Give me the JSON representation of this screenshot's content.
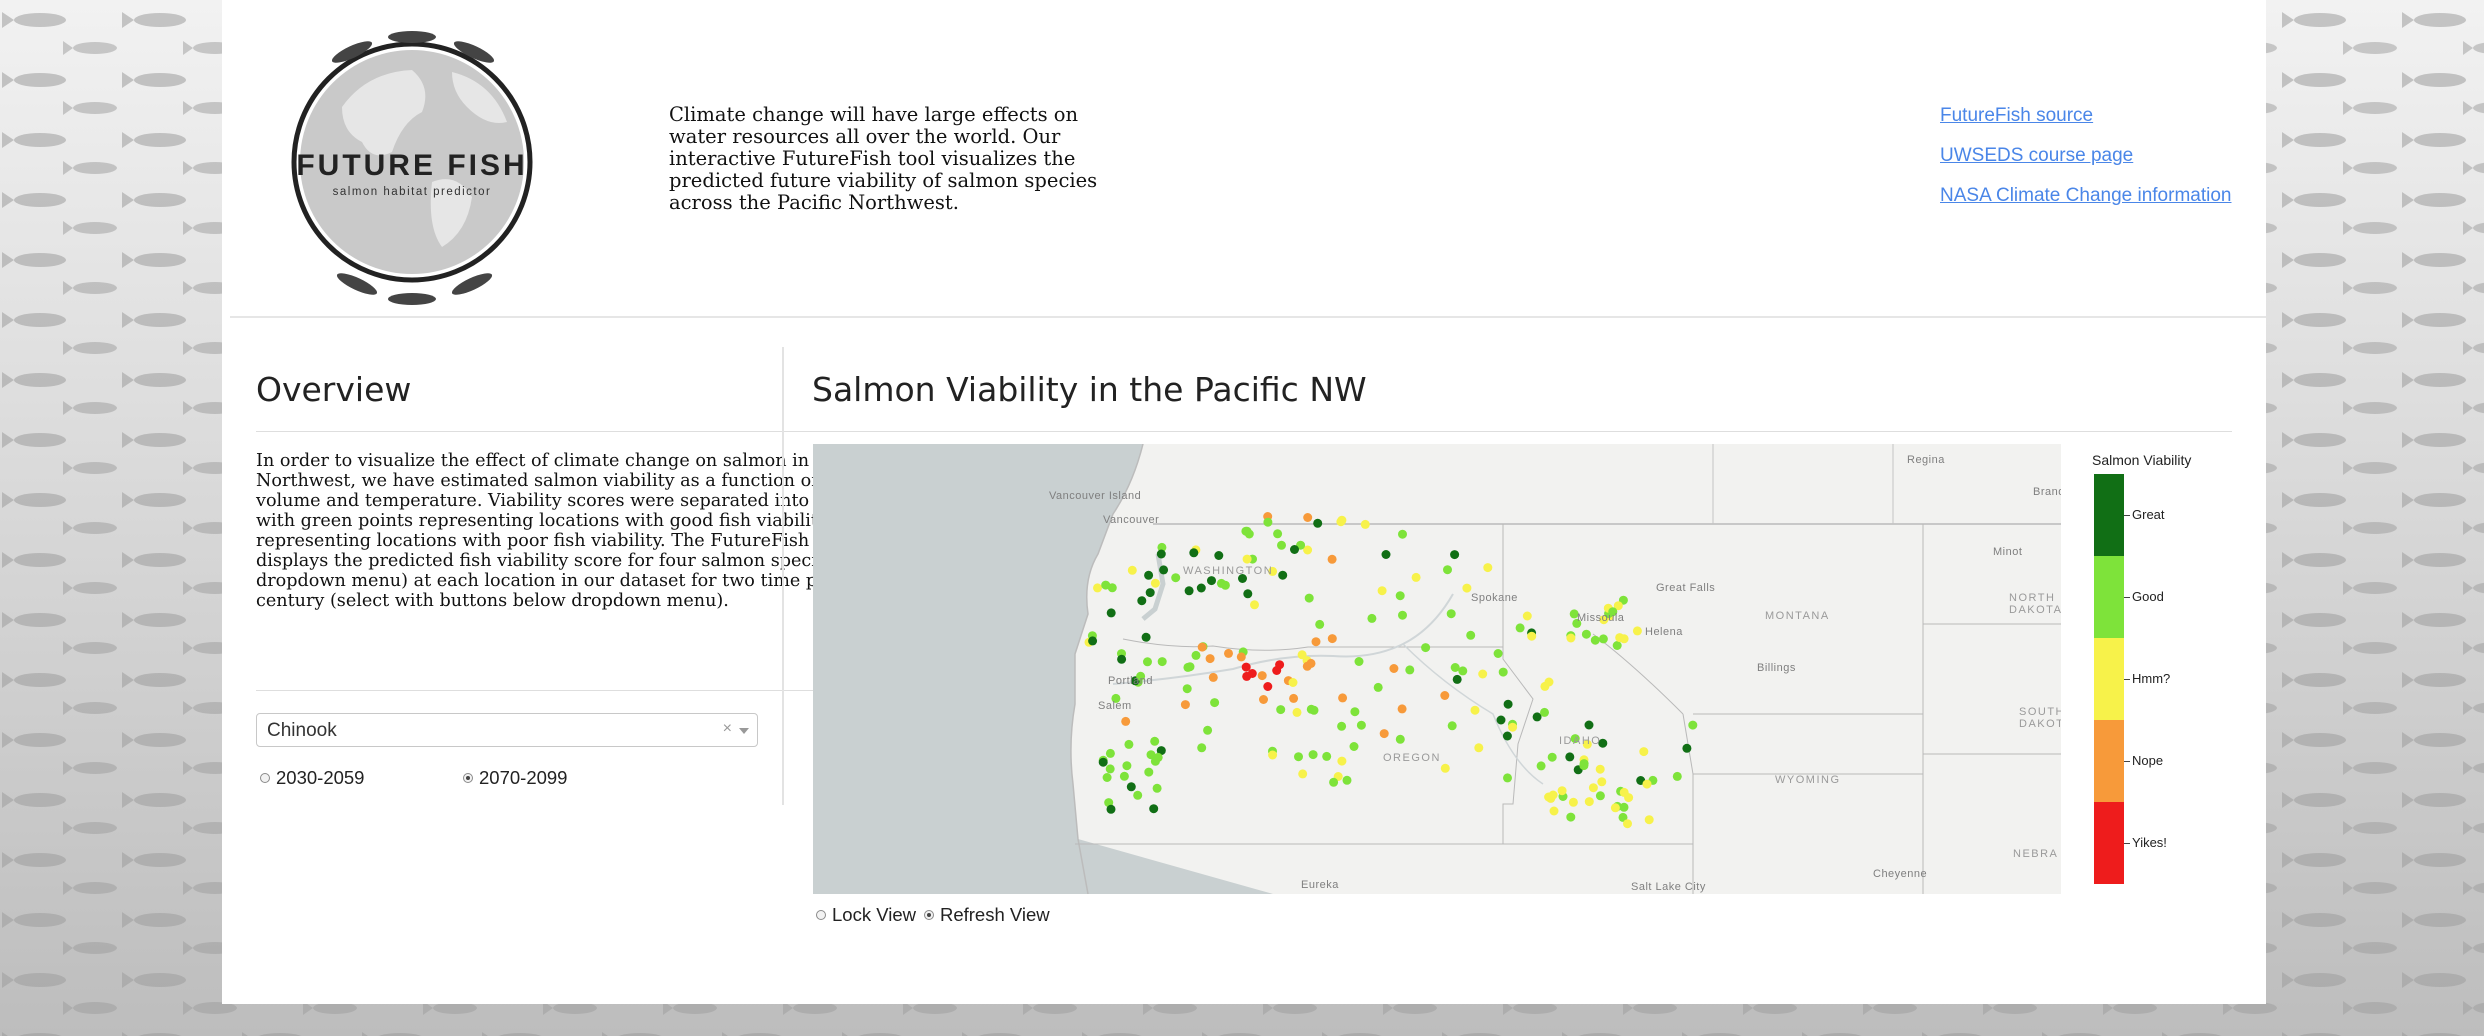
{
  "header": {
    "logo": {
      "title": "FUTURE FISH",
      "subtitle": "salmon habitat predictor"
    },
    "intro": "Climate change will have large effects on water resources all over the world. Our interactive FutureFish tool visualizes the predicted future viability of salmon species across the Pacific Northwest.",
    "links": [
      {
        "label": "FutureFish source"
      },
      {
        "label": "UWSEDS course page"
      },
      {
        "label": "NASA Climate Change information"
      }
    ]
  },
  "overview": {
    "title": "Overview",
    "text": "In order to visualize the effect of climate change on salmon in the Pacific Northwest, we have estimated salmon viability as a function of future streamflow volume and temperature. Viability scores were separated into five categories, with green points representing locations with good fish viability, and red points representing locations with poor fish viability. The FutureFish map to the right displays the predicted fish viability score for four salmon species (select in dropdown menu) at each location in our dataset for two time periods in the next century (select with buttons below dropdown menu).",
    "species_select": {
      "value": "Chinook",
      "clear_glyph": "×"
    },
    "periods": [
      {
        "label": "2030-2059",
        "selected": false
      },
      {
        "label": "2070-2099",
        "selected": true
      }
    ]
  },
  "map_panel": {
    "title": "Salmon Viability in the Pacific NW",
    "place_labels": {
      "regina": "Regina",
      "brandon": "Brand",
      "vancouver_island": "Vancouver Island",
      "vancouver": "Vancouver",
      "washington": "WASHINGTON",
      "spokane": "Spokane",
      "great_falls": "Great Falls",
      "minot": "Minot",
      "north_dakota_1": "NORTH",
      "north_dakota_2": "DAKOTA",
      "missoula": "Missoula",
      "montana": "MONTANA",
      "helena": "Helena",
      "billings": "Billings",
      "portland": "Portland",
      "salem": "Salem",
      "south_dakota_1": "SOUTH",
      "south_dakota_2": "DAKOTA",
      "idaho": "IDAHO",
      "oregon": "OREGON",
      "wyoming": "WYOMING",
      "nebraska": "NEBRA",
      "cheyenne": "Cheyenne",
      "eureka": "Eureka",
      "salt_lake_city": "Salt Lake City"
    },
    "view_options": [
      {
        "label": "Lock View",
        "selected": false
      },
      {
        "label": "Refresh View",
        "selected": true
      }
    ]
  },
  "legend": {
    "title": "Salmon Viability",
    "categories": [
      {
        "label": "Great",
        "color": "#116f15"
      },
      {
        "label": "Good",
        "color": "#7ee33a"
      },
      {
        "label": "Hmm?",
        "color": "#f7f24a"
      },
      {
        "label": "Nope",
        "color": "#f79a3a"
      },
      {
        "label": "Yikes!",
        "color": "#ee1c1c"
      }
    ]
  }
}
